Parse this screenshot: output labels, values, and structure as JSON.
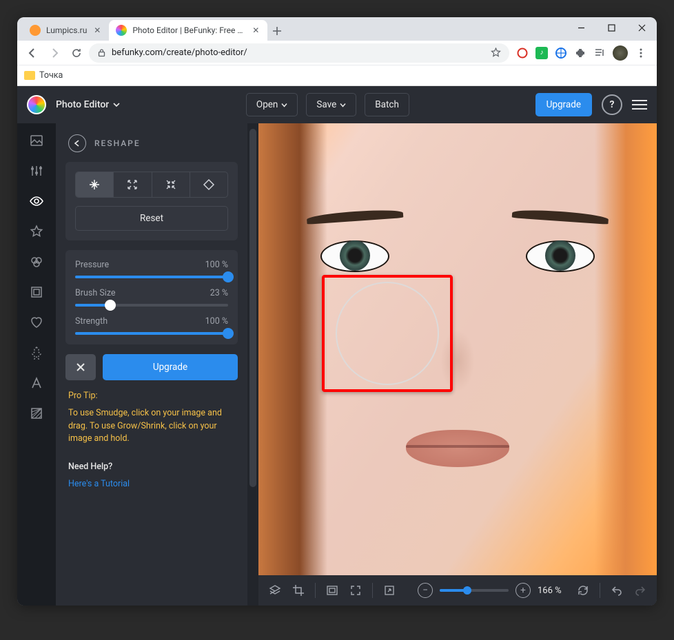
{
  "browser": {
    "tabs": [
      {
        "label": "Lumpics.ru",
        "favicon": "#ff9933",
        "active": false
      },
      {
        "label": "Photo Editor | BeFunky: Free Onl",
        "favicon": "gradient",
        "active": true
      }
    ],
    "url": "befunky.com/create/photo-editor/",
    "bookmarks": [
      {
        "label": "Точка"
      }
    ]
  },
  "header": {
    "mode": "Photo Editor",
    "open": "Open",
    "save": "Save",
    "batch": "Batch",
    "upgrade": "Upgrade"
  },
  "panel": {
    "title": "RESHAPE",
    "reset": "Reset",
    "sliders": {
      "pressure": {
        "label": "Pressure",
        "value": "100 %",
        "pct": 100
      },
      "brush": {
        "label": "Brush Size",
        "value": "23 %",
        "pct": 23
      },
      "strength": {
        "label": "Strength",
        "value": "100 %",
        "pct": 100
      }
    },
    "upgrade": "Upgrade",
    "tip_title": "Pro Tip:",
    "tip_text": "To use Smudge, click on your image and drag. To use Grow/Shrink, click on your image and hold.",
    "help_title": "Need Help?",
    "help_link": "Here's a Tutorial"
  },
  "bottombar": {
    "zoom_pct": 40,
    "zoom_label": "166 %"
  }
}
